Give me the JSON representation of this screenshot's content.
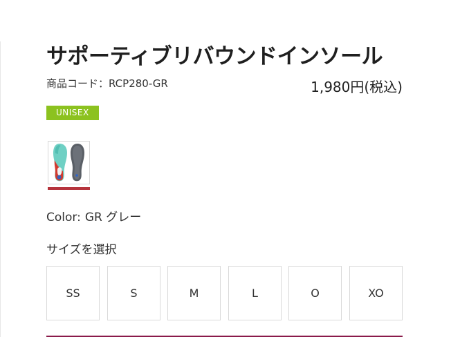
{
  "product": {
    "title": "サポーティブリバウンドインソール",
    "code_label": "商品コード：RCP280-GR",
    "price": "1,980円(税込)",
    "badge": "UNISEX"
  },
  "color": {
    "label": "Color:",
    "value": "GR グレー",
    "swatch_underline": "#b5333c"
  },
  "size": {
    "heading": "サイズを選択",
    "options": [
      "SS",
      "S",
      "M",
      "L",
      "O",
      "XO"
    ]
  },
  "colors": {
    "badge_bg": "#8cc21f",
    "accent_rule": "#8a1b4a"
  }
}
